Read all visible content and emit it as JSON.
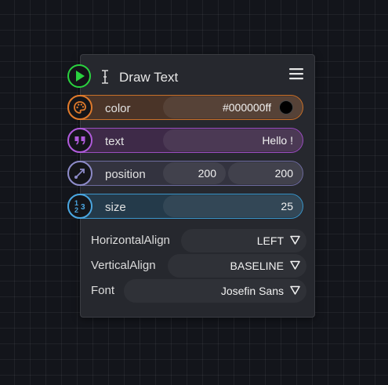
{
  "node": {
    "title": "Draw Text",
    "icons": {
      "run": "play-icon",
      "cursor": "text-cursor-icon",
      "menu": "hamburger-menu-icon"
    }
  },
  "params": {
    "color": {
      "label": "color",
      "value": "#000000ff",
      "swatch": "#000000",
      "icon": "palette-icon",
      "accent": "#e07a2b"
    },
    "text": {
      "label": "text",
      "value": "Hello !",
      "icon": "quote-icon",
      "accent": "#b05bdb"
    },
    "position": {
      "label": "position",
      "x": "200",
      "y": "200",
      "icon": "vector-arrow-icon",
      "accent": "#8d8bc8"
    },
    "size": {
      "label": "size",
      "value": "25",
      "icon": "numbers-icon",
      "accent": "#4aa6e0"
    }
  },
  "options": {
    "horizontal_align": {
      "label": "HorizontalAlign",
      "value": "LEFT"
    },
    "vertical_align": {
      "label": "VerticalAlign",
      "value": "BASELINE"
    },
    "font": {
      "label": "Font",
      "value": "Josefin Sans"
    }
  }
}
